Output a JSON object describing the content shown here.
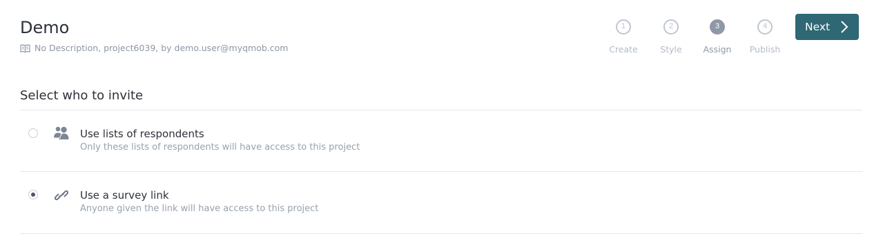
{
  "header": {
    "title": "Demo",
    "subtitle": "No Description, project6039, by demo.user@myqmob.com",
    "subtitle_icon": "book-icon"
  },
  "steps": [
    {
      "number": "1",
      "label": "Create",
      "active": false
    },
    {
      "number": "2",
      "label": "Style",
      "active": false
    },
    {
      "number": "3",
      "label": "Assign",
      "active": true
    },
    {
      "number": "4",
      "label": "Publish",
      "active": false
    }
  ],
  "next_button": {
    "label": "Next",
    "icon": "chevron-right-icon"
  },
  "section": {
    "title": "Select who to invite",
    "options": [
      {
        "title": "Use lists of respondents",
        "description": "Only these lists of respondents will have access to this project",
        "icon": "users-icon",
        "selected": false
      },
      {
        "title": "Use a survey link",
        "description": "Anyone given the link will have access to this project",
        "icon": "link-icon",
        "selected": true
      }
    ]
  },
  "colors": {
    "accent": "#2f6874",
    "active_step": "#8f98a6",
    "muted_text": "#8c97a6"
  }
}
